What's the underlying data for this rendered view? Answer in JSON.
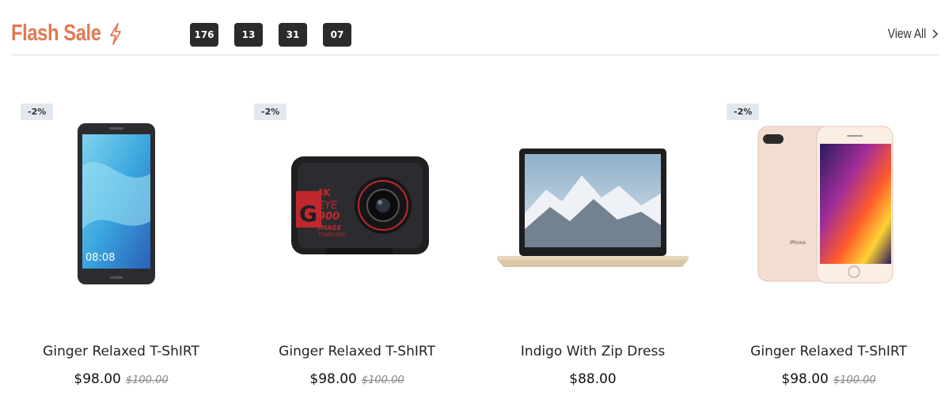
{
  "header": {
    "title": "Flash Sale",
    "timer": [
      "176",
      "13",
      "31",
      "07"
    ],
    "view_all": "View All"
  },
  "products": [
    {
      "badge": "-2%",
      "name": "Ginger Relaxed T-ShIRT",
      "price": "$98.00",
      "old_price": "$100.00",
      "image_icon": "smartphone-icon",
      "phone_time": "08:08",
      "phone_brand": "HUAWEI"
    },
    {
      "badge": "-2%",
      "name": "Ginger Relaxed T-ShIRT",
      "price": "$98.00",
      "old_price": "$100.00",
      "image_icon": "action-camera-icon",
      "cam_4k": "4K",
      "cam_brand_1": "G",
      "cam_brand_2": "EYE",
      "cam_brand_3": "900",
      "cam_sub_1": "IMAGE",
      "cam_sub_2": "STABILIZER"
    },
    {
      "badge": "",
      "name": "Indigo With Zip Dress",
      "price": "$88.00",
      "old_price": "",
      "image_icon": "laptop-icon"
    },
    {
      "badge": "-2%",
      "name": "Ginger Relaxed T-ShIRT",
      "price": "$98.00",
      "old_price": "$100.00",
      "image_icon": "iphone-icon",
      "phone_label": "iPhone"
    }
  ],
  "colors": {
    "accent": "#e07a52",
    "timer_bg": "#2b2b2b",
    "badge_bg": "#e3e8ef"
  }
}
